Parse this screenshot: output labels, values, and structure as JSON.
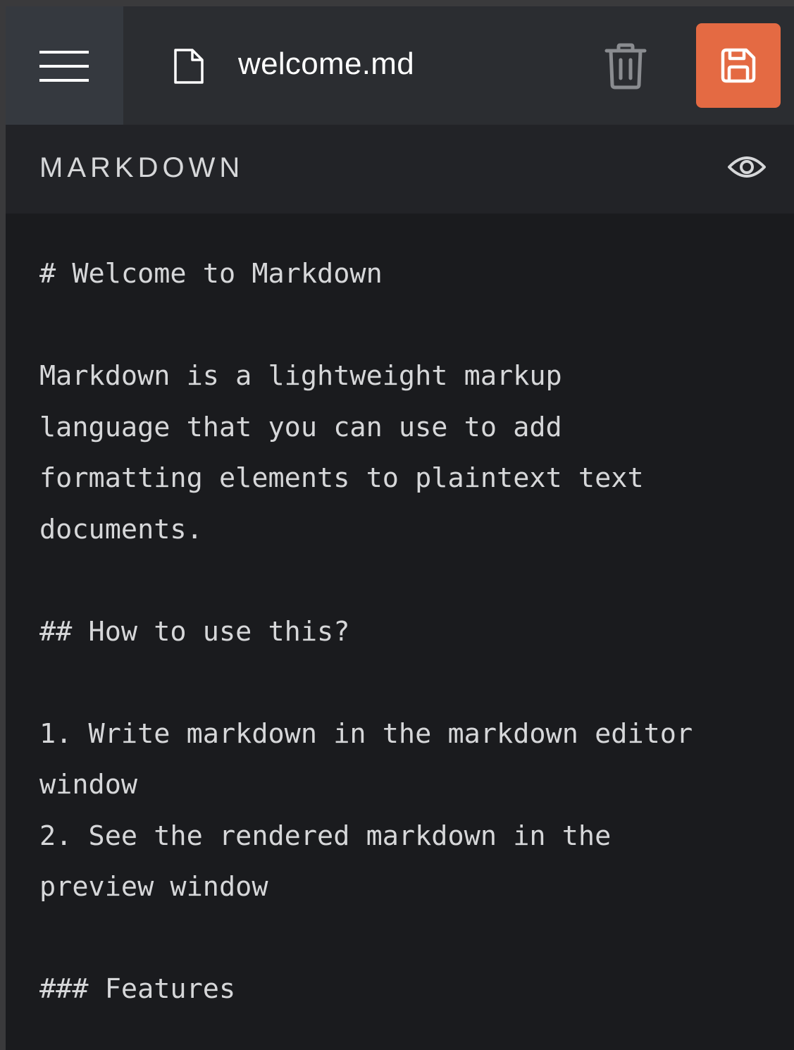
{
  "topbar": {
    "menu_icon": "hamburger-menu-icon",
    "document_icon": "document-icon",
    "filename": "welcome.md",
    "delete_icon": "trash-icon",
    "save_icon": "save-icon",
    "save_color": "#e46a43"
  },
  "panel": {
    "title": "MARKDOWN",
    "preview_icon": "eye-icon"
  },
  "editor": {
    "content": "# Welcome to Markdown\n\nMarkdown is a lightweight markup\nlanguage that you can use to add\nformatting elements to plaintext text\ndocuments.\n\n## How to use this?\n\n1. Write markdown in the markdown editor\nwindow\n2. See the rendered markdown in the\npreview window\n\n### Features"
  }
}
